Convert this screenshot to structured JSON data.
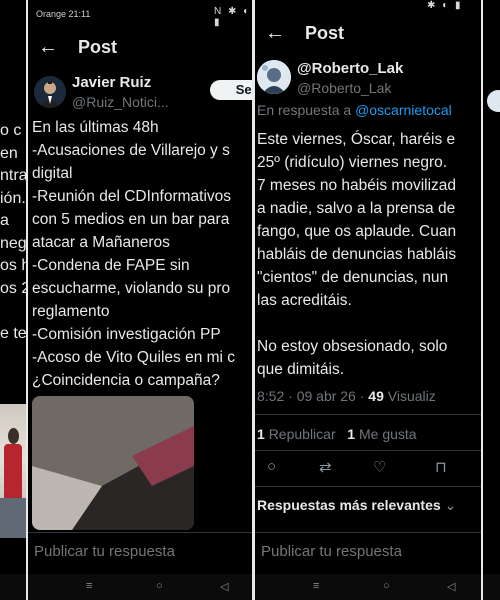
{
  "left_panel": {
    "lines": [
      "o c",
      "en",
      "ntra",
      "ión.",
      "a",
      "neg",
      "os h",
      "os 2",
      "",
      "e te"
    ]
  },
  "mid_panel": {
    "status": {
      "carrier": "Orange 21:11",
      "icons": "N ✱ ◐ ▮"
    },
    "header_title": "Post",
    "author": {
      "name": "Javier Ruiz",
      "handle": "@Ruiz_Notici..."
    },
    "follow_label": "Seguir",
    "tweet_lines": [
      "En las últimas 48h",
      "-Acusaciones de Villarejo y s",
      "digital",
      "-Reunión del CDInformativos",
      "con 5 medios en un bar para",
      "atacar a Mañaneros",
      "-Condena de FAPE sin",
      "escucharme, violando su pro",
      "reglamento",
      "-Comisión investigación PP",
      "-Acoso de Vito Quiles en mi c",
      "¿Coincidencia o campaña?"
    ],
    "reply_placeholder": "Publicar tu respuesta"
  },
  "right_panel": {
    "status": {
      "icons": "✱ ◐ ▮"
    },
    "header_title": "Post",
    "author": {
      "name": "@Roberto_Lak",
      "handle": "@Roberto_Lak"
    },
    "reply_to_prefix": "En respuesta a",
    "reply_to_mention": "@oscarnietocal",
    "tweet_lines": [
      "Este viernes, Óscar, haréis e",
      "25º (ridículo) viernes negro.",
      "7 meses no habéis movilizad",
      "a nadie, salvo a la prensa de",
      "fango, que os aplaude. Cuan",
      "habláis de denuncias habláis",
      "\"cientos\" de denuncias, nun",
      "las acreditáis.",
      "",
      "No estoy obsesionado, solo",
      "que dimitáis."
    ],
    "meta": {
      "time_date": "8:52 · 09 abr 26 ·",
      "views_count": "49",
      "views_label": "Visualiz"
    },
    "stats": {
      "reposts_count": "1",
      "reposts_label": "Republicar",
      "likes_count": "1",
      "likes_label": "Me gusta"
    },
    "sort_label": "Respuestas más relevantes",
    "reply_placeholder": "Publicar tu respuesta"
  },
  "navbar": {
    "icons": [
      "≡",
      "○",
      "◁"
    ]
  }
}
